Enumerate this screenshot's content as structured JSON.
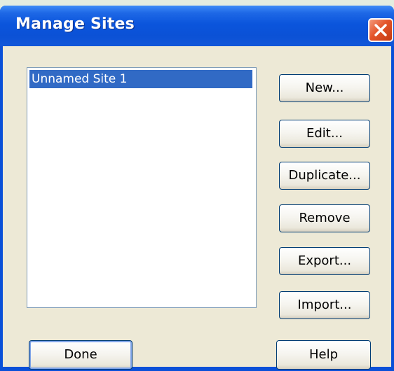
{
  "window": {
    "title": "Manage Sites"
  },
  "site_list": {
    "items": [
      {
        "label": "Unnamed Site 1",
        "selected": true
      }
    ]
  },
  "buttons": {
    "new": "New...",
    "edit": "Edit...",
    "duplicate": "Duplicate...",
    "remove": "Remove",
    "export": "Export...",
    "import": "Import...",
    "done": "Done",
    "help": "Help"
  },
  "icons": {
    "close": "close-icon"
  },
  "colors": {
    "titlebar": "#0b55dc",
    "close_button": "#e4552b",
    "selection": "#316ac5",
    "dialog_background": "#ede9d6"
  }
}
